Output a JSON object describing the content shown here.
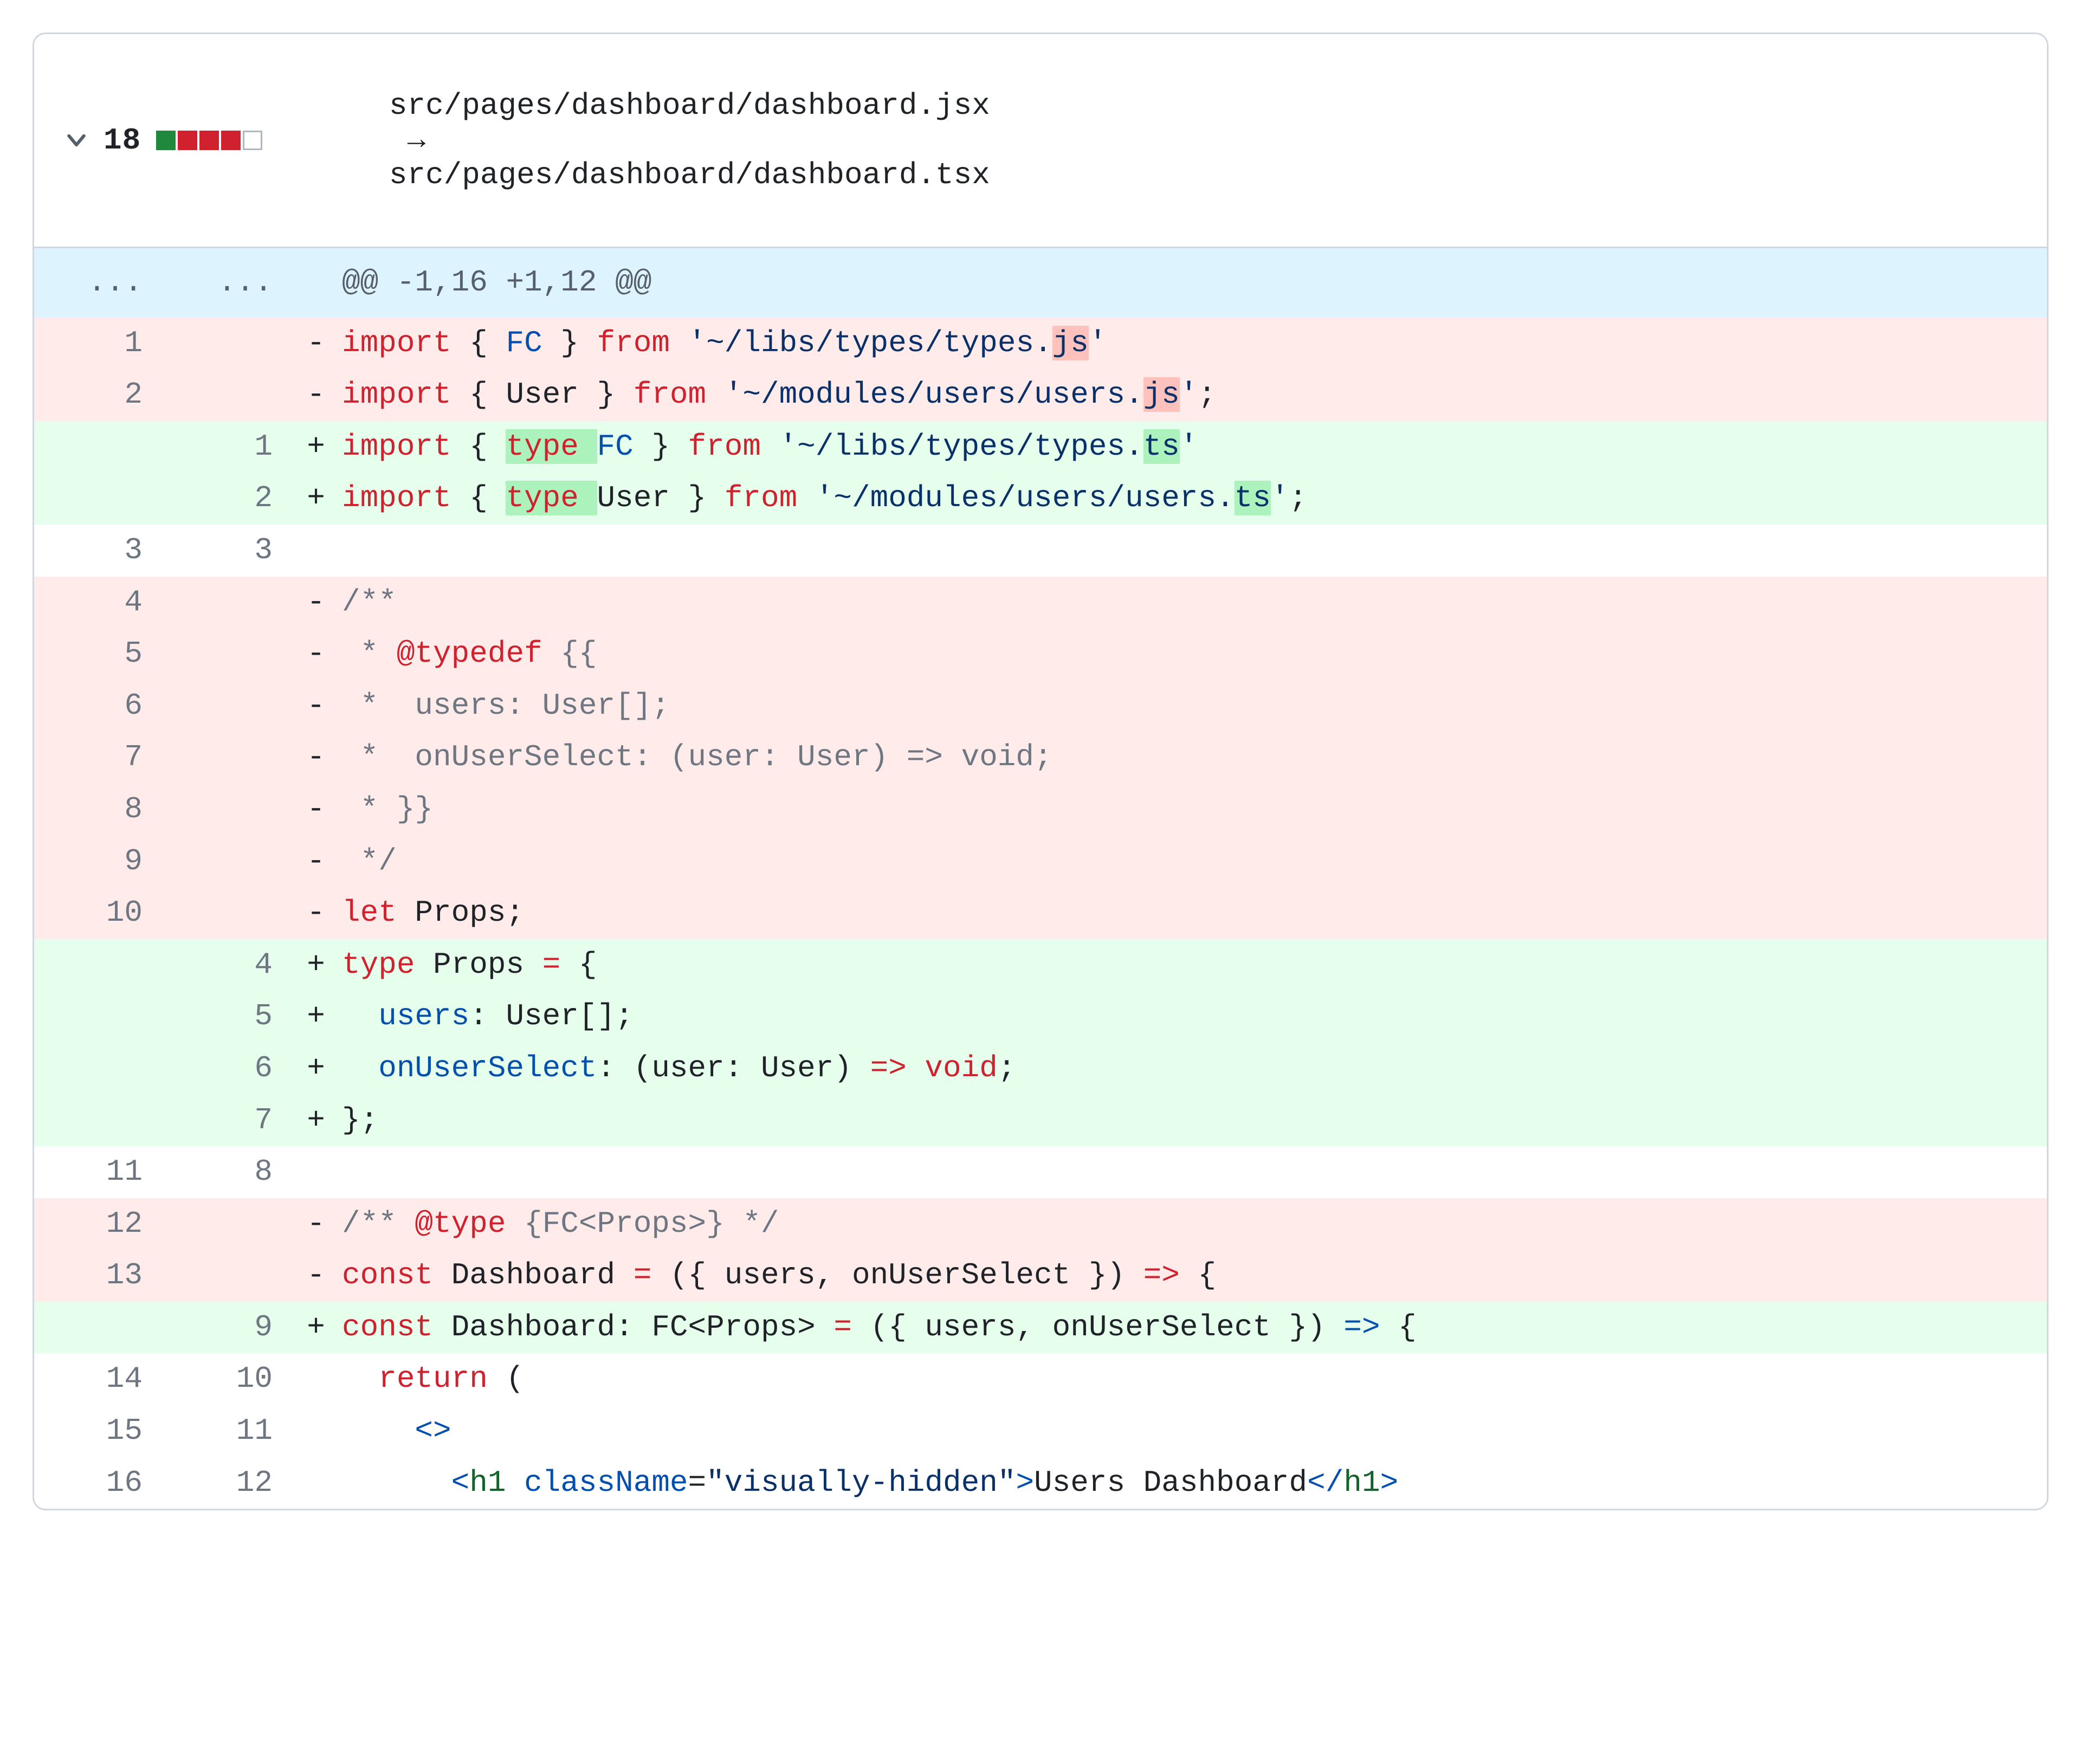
{
  "header": {
    "change_count": "18",
    "diffstat": [
      "add",
      "del",
      "del",
      "del",
      "neutral"
    ],
    "path_old": "src/pages/dashboard/dashboard.jsx",
    "arrow": "→",
    "path_new": "src/pages/dashboard/dashboard.tsx"
  },
  "hunk_header": {
    "old_marker": "...",
    "new_marker": "...",
    "text": "@@ -1,16 +1,12 @@"
  },
  "lines": [
    {
      "type": "del",
      "old": "1",
      "new": "",
      "sign": "-",
      "tokens": [
        {
          "t": "import",
          "c": "t-red"
        },
        {
          "t": " { ",
          "c": "t-black"
        },
        {
          "t": "FC",
          "c": "t-blue"
        },
        {
          "t": " } ",
          "c": "t-black"
        },
        {
          "t": "from",
          "c": "t-red"
        },
        {
          "t": " ",
          "c": ""
        },
        {
          "t": "'~/libs/types/types.",
          "c": "t-navy"
        },
        {
          "t": "js",
          "c": "t-navy",
          "hl": "del"
        },
        {
          "t": "'",
          "c": "t-navy"
        }
      ]
    },
    {
      "type": "del",
      "old": "2",
      "new": "",
      "sign": "-",
      "tokens": [
        {
          "t": "import",
          "c": "t-red"
        },
        {
          "t": " { ",
          "c": "t-black"
        },
        {
          "t": "User",
          "c": "t-black"
        },
        {
          "t": " } ",
          "c": "t-black"
        },
        {
          "t": "from",
          "c": "t-red"
        },
        {
          "t": " ",
          "c": ""
        },
        {
          "t": "'~/modules/users/users.",
          "c": "t-navy"
        },
        {
          "t": "js",
          "c": "t-navy",
          "hl": "del"
        },
        {
          "t": "'",
          "c": "t-navy"
        },
        {
          "t": ";",
          "c": "t-black"
        }
      ]
    },
    {
      "type": "add",
      "old": "",
      "new": "1",
      "sign": "+",
      "tokens": [
        {
          "t": "import",
          "c": "t-red"
        },
        {
          "t": " { ",
          "c": "t-black"
        },
        {
          "t": "type ",
          "c": "t-red",
          "hl": "add"
        },
        {
          "t": "FC",
          "c": "t-blue"
        },
        {
          "t": " } ",
          "c": "t-black"
        },
        {
          "t": "from",
          "c": "t-red"
        },
        {
          "t": " ",
          "c": ""
        },
        {
          "t": "'~/libs/types/types.",
          "c": "t-navy"
        },
        {
          "t": "ts",
          "c": "t-navy",
          "hl": "add"
        },
        {
          "t": "'",
          "c": "t-navy"
        }
      ]
    },
    {
      "type": "add",
      "old": "",
      "new": "2",
      "sign": "+",
      "tokens": [
        {
          "t": "import",
          "c": "t-red"
        },
        {
          "t": " { ",
          "c": "t-black"
        },
        {
          "t": "type ",
          "c": "t-red",
          "hl": "add"
        },
        {
          "t": "User",
          "c": "t-black"
        },
        {
          "t": " } ",
          "c": "t-black"
        },
        {
          "t": "from",
          "c": "t-red"
        },
        {
          "t": " ",
          "c": ""
        },
        {
          "t": "'~/modules/users/users.",
          "c": "t-navy"
        },
        {
          "t": "ts",
          "c": "t-navy",
          "hl": "add"
        },
        {
          "t": "'",
          "c": "t-navy"
        },
        {
          "t": ";",
          "c": "t-black"
        }
      ]
    },
    {
      "type": "ctx",
      "old": "3",
      "new": "3",
      "sign": "",
      "tokens": [
        {
          "t": "",
          "c": ""
        }
      ]
    },
    {
      "type": "del",
      "old": "4",
      "new": "",
      "sign": "-",
      "tokens": [
        {
          "t": "/**",
          "c": "t-gray"
        }
      ]
    },
    {
      "type": "del",
      "old": "5",
      "new": "",
      "sign": "-",
      "tokens": [
        {
          "t": " * ",
          "c": "t-gray"
        },
        {
          "t": "@typedef",
          "c": "t-red"
        },
        {
          "t": " {{",
          "c": "t-gray"
        }
      ]
    },
    {
      "type": "del",
      "old": "6",
      "new": "",
      "sign": "-",
      "tokens": [
        {
          "t": " *  users: User[];",
          "c": "t-gray"
        }
      ]
    },
    {
      "type": "del",
      "old": "7",
      "new": "",
      "sign": "-",
      "tokens": [
        {
          "t": " *  onUserSelect: (user: User) => void;",
          "c": "t-gray"
        }
      ]
    },
    {
      "type": "del",
      "old": "8",
      "new": "",
      "sign": "-",
      "tokens": [
        {
          "t": " * }}",
          "c": "t-gray"
        }
      ]
    },
    {
      "type": "del",
      "old": "9",
      "new": "",
      "sign": "-",
      "tokens": [
        {
          "t": " */",
          "c": "t-gray"
        }
      ]
    },
    {
      "type": "del",
      "old": "10",
      "new": "",
      "sign": "-",
      "tokens": [
        {
          "t": "let",
          "c": "t-red"
        },
        {
          "t": " Props;",
          "c": "t-black"
        }
      ]
    },
    {
      "type": "add",
      "old": "",
      "new": "4",
      "sign": "+",
      "tokens": [
        {
          "t": "type",
          "c": "t-red"
        },
        {
          "t": " ",
          "c": ""
        },
        {
          "t": "Props",
          "c": "t-black"
        },
        {
          "t": " ",
          "c": ""
        },
        {
          "t": "=",
          "c": "t-red"
        },
        {
          "t": " {",
          "c": "t-black"
        }
      ]
    },
    {
      "type": "add",
      "old": "",
      "new": "5",
      "sign": "+",
      "tokens": [
        {
          "t": "  ",
          "c": ""
        },
        {
          "t": "users",
          "c": "t-blue"
        },
        {
          "t": ": ",
          "c": "t-black"
        },
        {
          "t": "User",
          "c": "t-black"
        },
        {
          "t": "[];",
          "c": "t-black"
        }
      ]
    },
    {
      "type": "add",
      "old": "",
      "new": "6",
      "sign": "+",
      "tokens": [
        {
          "t": "  ",
          "c": ""
        },
        {
          "t": "onUserSelect",
          "c": "t-blue"
        },
        {
          "t": ": (",
          "c": "t-black"
        },
        {
          "t": "user",
          "c": "t-black"
        },
        {
          "t": ": ",
          "c": "t-black"
        },
        {
          "t": "User",
          "c": "t-black"
        },
        {
          "t": ") ",
          "c": "t-black"
        },
        {
          "t": "=>",
          "c": "t-red"
        },
        {
          "t": " ",
          "c": ""
        },
        {
          "t": "void",
          "c": "t-red"
        },
        {
          "t": ";",
          "c": "t-black"
        }
      ]
    },
    {
      "type": "add",
      "old": "",
      "new": "7",
      "sign": "+",
      "tokens": [
        {
          "t": "};",
          "c": "t-black"
        }
      ]
    },
    {
      "type": "ctx",
      "old": "11",
      "new": "8",
      "sign": "",
      "tokens": [
        {
          "t": "",
          "c": ""
        }
      ]
    },
    {
      "type": "del",
      "old": "12",
      "new": "",
      "sign": "-",
      "tokens": [
        {
          "t": "/** ",
          "c": "t-gray"
        },
        {
          "t": "@type",
          "c": "t-red"
        },
        {
          "t": " {FC<Props>} */",
          "c": "t-gray"
        }
      ]
    },
    {
      "type": "del",
      "old": "13",
      "new": "",
      "sign": "-",
      "tokens": [
        {
          "t": "const",
          "c": "t-red"
        },
        {
          "t": " ",
          "c": ""
        },
        {
          "t": "Dashboard",
          "c": "t-black"
        },
        {
          "t": " ",
          "c": ""
        },
        {
          "t": "=",
          "c": "t-red"
        },
        {
          "t": " ({ users, onUserSelect }) ",
          "c": "t-black"
        },
        {
          "t": "=>",
          "c": "t-red"
        },
        {
          "t": " {",
          "c": "t-black"
        }
      ]
    },
    {
      "type": "add",
      "old": "",
      "new": "9",
      "sign": "+",
      "tokens": [
        {
          "t": "const",
          "c": "t-red"
        },
        {
          "t": " ",
          "c": ""
        },
        {
          "t": "Dashboard",
          "c": "t-black"
        },
        {
          "t": ": ",
          "c": "t-black"
        },
        {
          "t": "FC",
          "c": "t-black"
        },
        {
          "t": "<",
          "c": "t-black"
        },
        {
          "t": "Props",
          "c": "t-black"
        },
        {
          "t": "> ",
          "c": "t-black"
        },
        {
          "t": "=",
          "c": "t-red"
        },
        {
          "t": " ({ users, onUserSelect }) ",
          "c": "t-black"
        },
        {
          "t": "=>",
          "c": "t-blue"
        },
        {
          "t": " {",
          "c": "t-black"
        }
      ]
    },
    {
      "type": "ctx",
      "old": "14",
      "new": "10",
      "sign": "",
      "tokens": [
        {
          "t": "  ",
          "c": ""
        },
        {
          "t": "return",
          "c": "t-red"
        },
        {
          "t": " (",
          "c": "t-black"
        }
      ]
    },
    {
      "type": "ctx",
      "old": "15",
      "new": "11",
      "sign": "",
      "tokens": [
        {
          "t": "    ",
          "c": ""
        },
        {
          "t": "<>",
          "c": "t-blue"
        }
      ]
    },
    {
      "type": "ctx",
      "old": "16",
      "new": "12",
      "sign": "",
      "tokens": [
        {
          "t": "      ",
          "c": ""
        },
        {
          "t": "<",
          "c": "t-blue"
        },
        {
          "t": "h1",
          "c": "t-green"
        },
        {
          "t": " ",
          "c": ""
        },
        {
          "t": "className",
          "c": "t-blue"
        },
        {
          "t": "=",
          "c": "t-black"
        },
        {
          "t": "\"visually-hidden\"",
          "c": "t-navy"
        },
        {
          "t": ">",
          "c": "t-blue"
        },
        {
          "t": "Users Dashboard",
          "c": "t-black"
        },
        {
          "t": "</",
          "c": "t-blue"
        },
        {
          "t": "h1",
          "c": "t-green"
        },
        {
          "t": ">",
          "c": "t-blue"
        }
      ]
    }
  ]
}
